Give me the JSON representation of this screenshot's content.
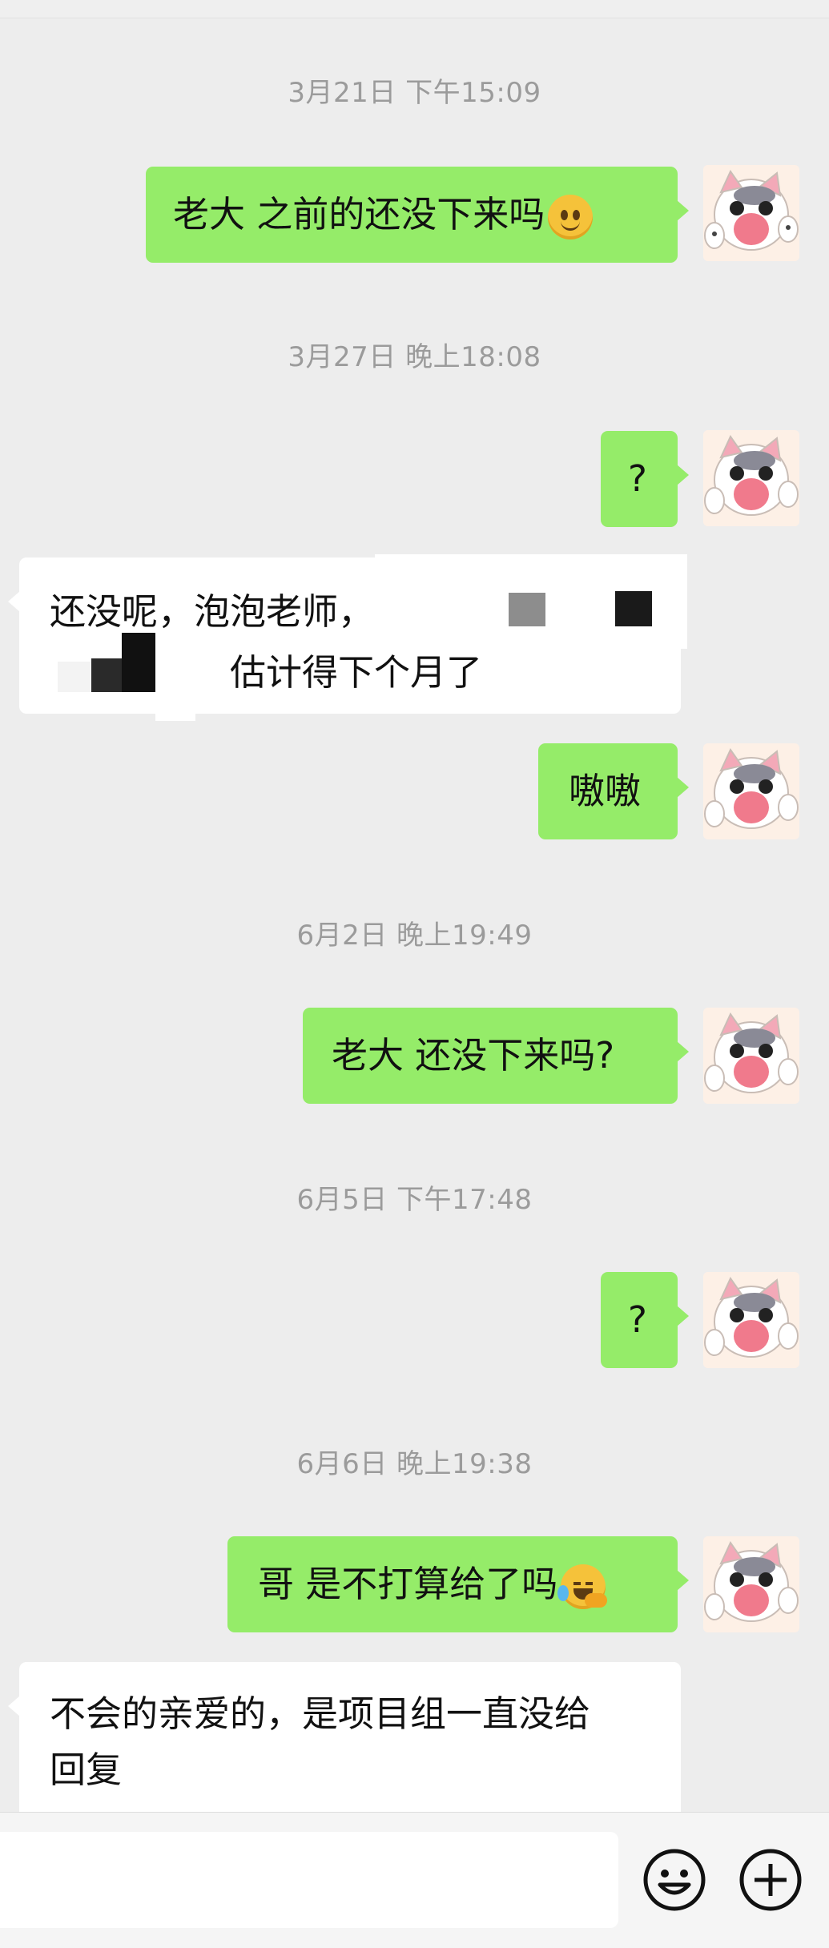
{
  "timestamps": [
    "3月21日 下午15:09",
    "3月27日 晚上18:08",
    "6月2日 晚上19:49",
    "6月5日 下午17:48",
    "6月6日 晚上19:38"
  ],
  "messages": {
    "m1": "老大 之前的还没下来吗",
    "m2": "?",
    "m3_line1": "还没呢，泡泡老师，",
    "m3_line2": "估计得下个月了",
    "m4": "嗷嗷",
    "m5": "老大 还没下来吗?",
    "m6": "?",
    "m7": "哥 是不打算给了吗",
    "m8_line1": "不会的亲爱的，是项目组一直没给",
    "m8_line2": "回复"
  },
  "colors": {
    "outgoing_bubble": "#95ec69",
    "incoming_bubble": "#ffffff",
    "background": "#ededed"
  },
  "icons": {
    "emoji_smile": "slightly-smiling-face",
    "emoji_laugh": "rolling-on-floor-laughing",
    "emoji_button": "smiley-face-icon",
    "plus_button": "plus-circle-icon"
  }
}
